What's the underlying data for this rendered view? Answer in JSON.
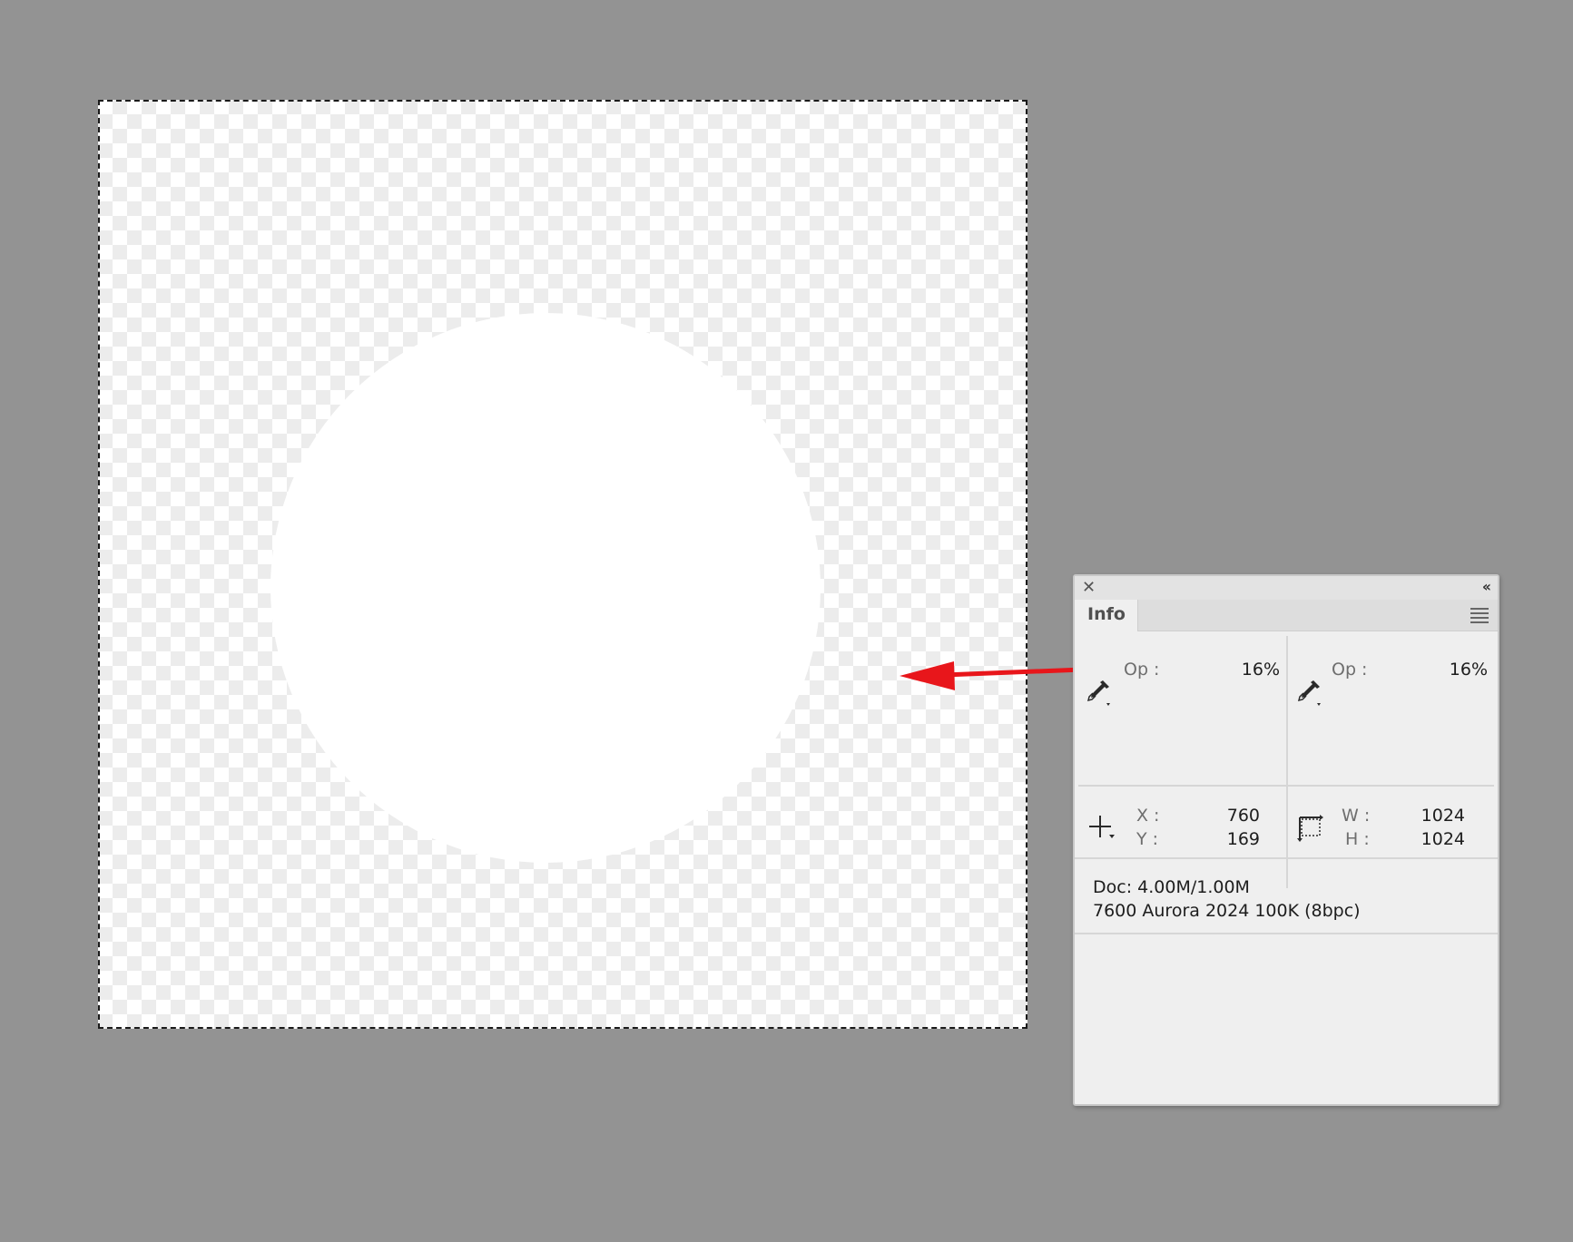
{
  "colors": {
    "pasteboard": "#939393",
    "annotation_red": "#e8161b",
    "panel_bg": "#efefef"
  },
  "panel": {
    "close_icon": "close-icon",
    "collapse_icon": "double-chevron-left-icon",
    "collapse_glyph": "‹‹",
    "close_glyph": "✕",
    "tab_label": "Info",
    "menu_icon": "panel-menu-icon",
    "left_readout": {
      "icon": "eyedropper-icon",
      "label": "Op :",
      "value": "16%"
    },
    "right_readout": {
      "icon": "eyedropper-icon",
      "label": "Op :",
      "value": "16%"
    },
    "position": {
      "icon": "crosshair-icon",
      "x_label": "X :",
      "x_value": "760",
      "y_label": "Y :",
      "y_value": "169"
    },
    "size": {
      "icon": "selection-size-icon",
      "w_label": "W :",
      "w_value": "1024",
      "h_label": "H :",
      "h_value": "1024"
    },
    "doc_info": "Doc: 4.00M/1.00M",
    "profile": "7600 Aurora 2024 100K (8bpc)"
  }
}
